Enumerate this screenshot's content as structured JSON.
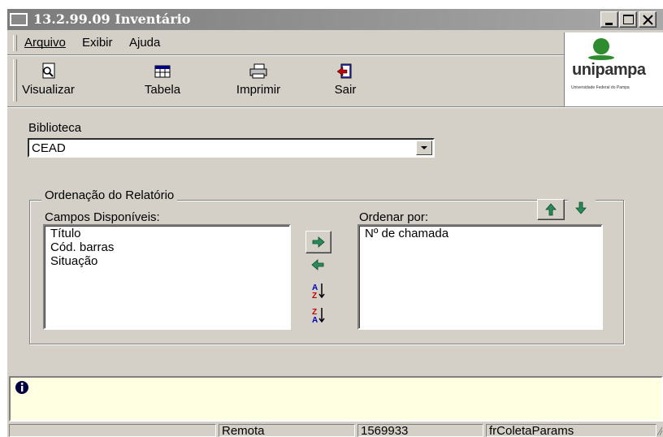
{
  "window": {
    "title": "13.2.99.09 Inventário"
  },
  "menu": {
    "items": [
      {
        "label": "Arquivo"
      },
      {
        "label": "Exibir"
      },
      {
        "label": "Ajuda"
      }
    ]
  },
  "toolbar": {
    "buttons": [
      {
        "label": "Visualizar",
        "icon": "preview-icon"
      },
      {
        "label": "Tabela",
        "icon": "table-icon"
      },
      {
        "label": "Imprimir",
        "icon": "printer-icon"
      },
      {
        "label": "Sair",
        "icon": "exit-door-icon"
      }
    ]
  },
  "logo": {
    "name": "unipampa",
    "subtitle": "Universidade Federal do Pampa"
  },
  "form": {
    "biblioteca_label": "Biblioteca",
    "biblioteca_value": "CEAD"
  },
  "ordenacao": {
    "group_title": "Ordenação do Relatório",
    "available_label": "Campos Disponíveis:",
    "available_items": [
      "Título",
      "Cód. barras",
      "Situação"
    ],
    "order_label": "Ordenar por:",
    "order_items": [
      "Nº de chamada"
    ]
  },
  "status": {
    "panel1": "",
    "panel2": "Remota",
    "panel3": "1569933",
    "panel4": "frColetaParams"
  },
  "colors": {
    "arrow_green": "#2a8a5a",
    "sort_red": "#c00000",
    "sort_blue": "#0000c0",
    "info_bg": "#ffffe1",
    "face": "#d4d0c8"
  }
}
